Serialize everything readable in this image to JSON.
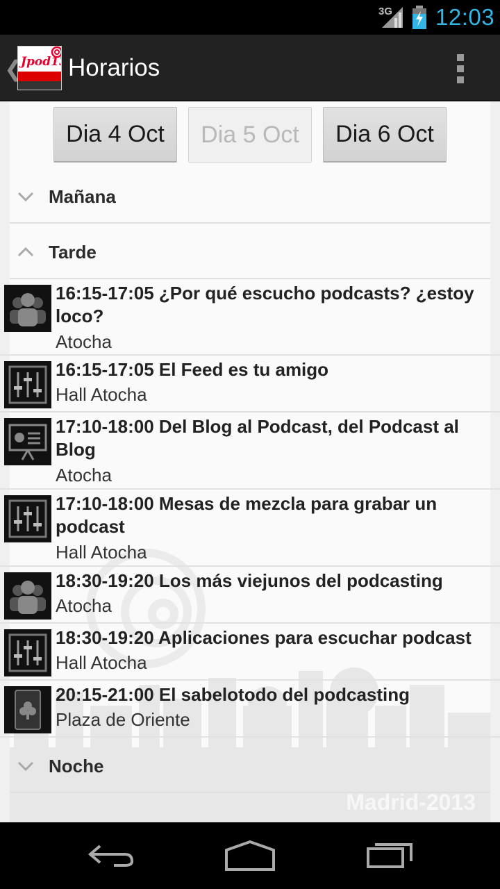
{
  "status_bar": {
    "network": "3G",
    "time": "12:03",
    "clock_color": "#33b5e5"
  },
  "action_bar": {
    "title": "Horarios",
    "logo_text": "Jpod13",
    "icons": [
      "up-caret-icon",
      "app-logo-icon",
      "overflow-menu-icon"
    ]
  },
  "day_tabs": [
    {
      "label": "Dia 4 Oct",
      "enabled": true
    },
    {
      "label": "Dia 5 Oct",
      "enabled": false
    },
    {
      "label": "Dia 6 Oct",
      "enabled": true
    }
  ],
  "groups": [
    {
      "label": "Mañana",
      "expanded": false
    },
    {
      "label": "Tarde",
      "expanded": true
    },
    {
      "label": "Noche",
      "expanded": false
    }
  ],
  "sessions": [
    {
      "title": "16:15-17:05 ¿Por qué escucho podcasts? ¿estoy loco?",
      "room": "Atocha",
      "icon": "people-icon"
    },
    {
      "title": "16:15-17:05 El Feed es tu amigo",
      "room": "Hall Atocha",
      "icon": "mixer-icon"
    },
    {
      "title": "17:10-18:00 Del Blog al Podcast, del Podcast al Blog",
      "room": "Atocha",
      "icon": "presentation-icon"
    },
    {
      "title": "17:10-18:00 Mesas de mezcla para grabar un podcast",
      "room": "Hall Atocha",
      "icon": "mixer-icon"
    },
    {
      "title": "18:30-19:20 Los más viejunos del podcasting",
      "room": "Atocha",
      "icon": "people-icon"
    },
    {
      "title": "18:30-19:20 Aplicaciones para escuchar podcast",
      "room": "Hall Atocha",
      "icon": "mixer-icon"
    },
    {
      "title": "20:15-21:00 El sabelotodo del podcasting",
      "room": "Plaza de Oriente",
      "icon": "card-icon"
    }
  ],
  "watermark": "Madrid-2013",
  "nav_bar": {
    "icons": [
      "back-icon",
      "home-icon",
      "recents-icon"
    ]
  }
}
